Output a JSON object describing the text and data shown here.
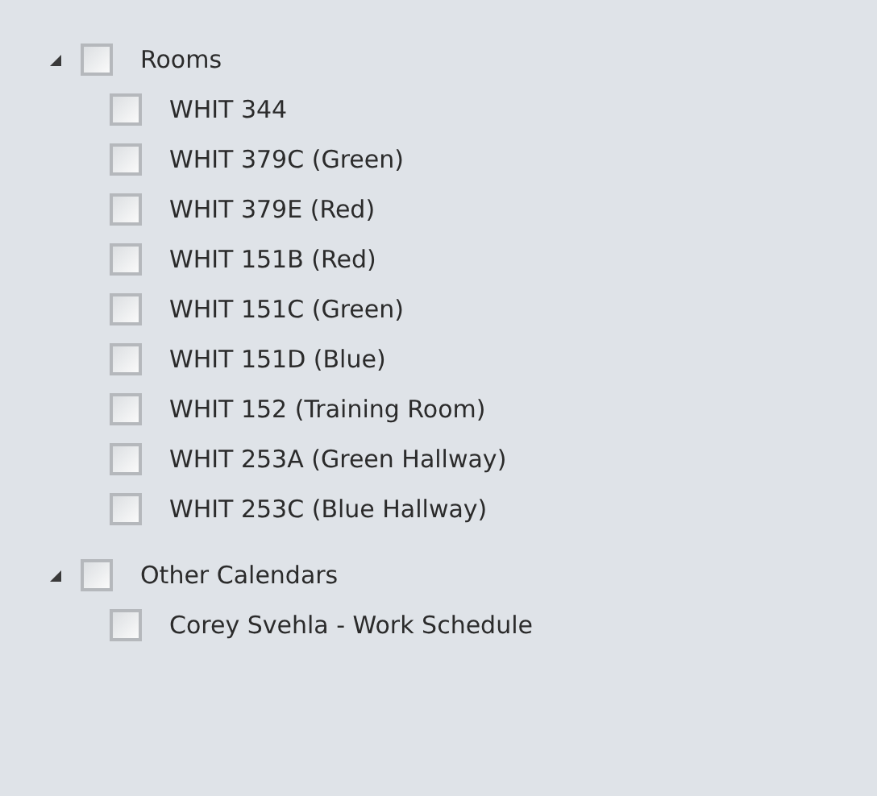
{
  "calendar_groups": [
    {
      "label": "Rooms",
      "expanded": true,
      "checked": false,
      "children": [
        {
          "label": "WHIT 344",
          "checked": false
        },
        {
          "label": "WHIT 379C (Green)",
          "checked": false
        },
        {
          "label": "WHIT 379E (Red)",
          "checked": false
        },
        {
          "label": "WHIT 151B (Red)",
          "checked": false
        },
        {
          "label": "WHIT 151C (Green)",
          "checked": false
        },
        {
          "label": "WHIT 151D (Blue)",
          "checked": false
        },
        {
          "label": "WHIT 152 (Training Room)",
          "checked": false
        },
        {
          "label": "WHIT 253A (Green Hallway)",
          "checked": false
        },
        {
          "label": "WHIT 253C (Blue Hallway)",
          "checked": false
        }
      ]
    },
    {
      "label": "Other Calendars",
      "expanded": true,
      "checked": false,
      "children": [
        {
          "label": "Corey Svehla - Work Schedule",
          "checked": false
        }
      ]
    }
  ]
}
